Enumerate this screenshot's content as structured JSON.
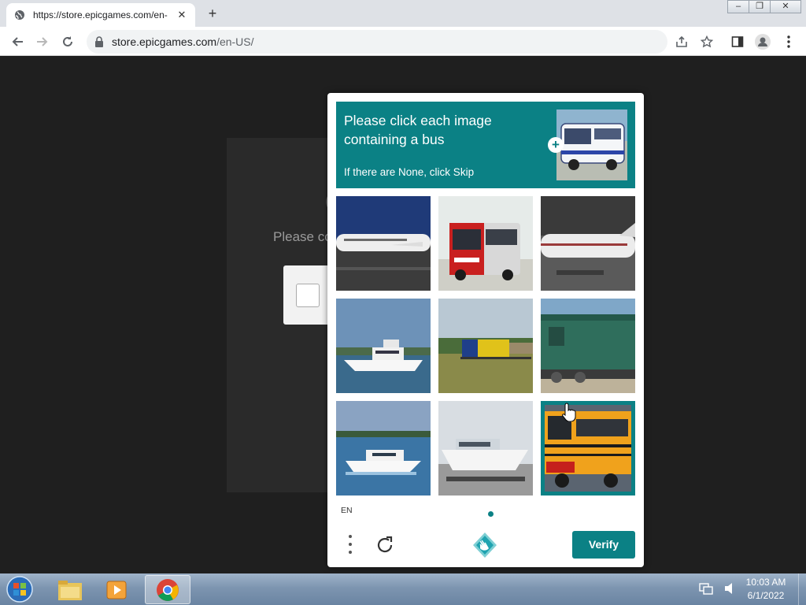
{
  "browser": {
    "tab_title": "https://store.epicgames.com/en-",
    "url_host": "store.epicgames.com",
    "url_path": "/en-US/"
  },
  "background_page": {
    "partial_text": "Please co"
  },
  "captcha": {
    "prompt_line": "Please click each image containing a bus",
    "skip_hint": "If there are None, click Skip",
    "language": "EN",
    "verify_label": "Verify",
    "accent_color": "#0b8185",
    "tiles": [
      {
        "subject": "airplane",
        "selected": false
      },
      {
        "subject": "bus",
        "selected": false
      },
      {
        "subject": "airplane",
        "selected": false
      },
      {
        "subject": "boat",
        "selected": false
      },
      {
        "subject": "train",
        "selected": false
      },
      {
        "subject": "train",
        "selected": false
      },
      {
        "subject": "boat",
        "selected": false
      },
      {
        "subject": "boat",
        "selected": false
      },
      {
        "subject": "school-bus",
        "selected": true
      }
    ]
  },
  "taskbar": {
    "time": "10:03 AM",
    "date": "6/1/2022"
  }
}
